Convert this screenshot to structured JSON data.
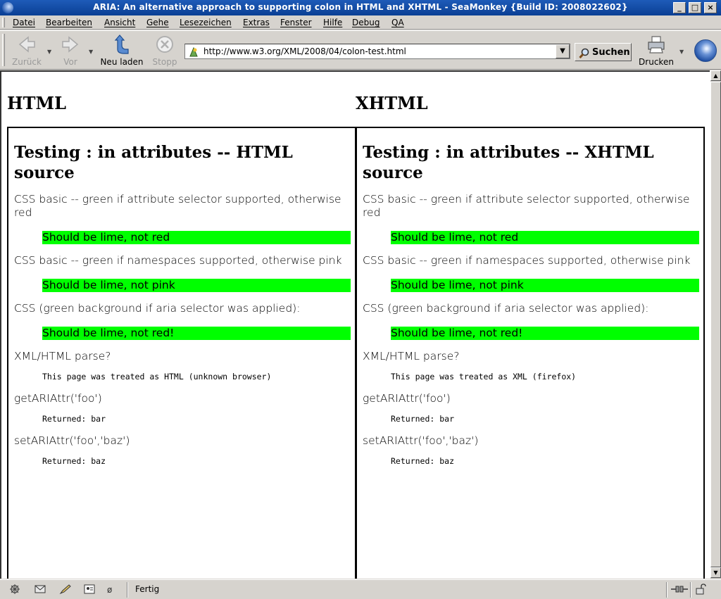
{
  "window": {
    "title": "ARIA: An alternative approach to supporting colon in HTML and XHTML - SeaMonkey {Build ID: 2008022602}"
  },
  "menu": [
    "Datei",
    "Bearbeiten",
    "Ansicht",
    "Gehe",
    "Lesezeichen",
    "Extras",
    "Fenster",
    "Hilfe",
    "Debug",
    "QA"
  ],
  "toolbar": {
    "back_label": "Zurück",
    "forward_label": "Vor",
    "reload_label": "Neu laden",
    "stop_label": "Stopp",
    "url": "http://www.w3.org/XML/2008/04/colon-test.html",
    "search_label": "Suchen",
    "print_label": "Drucken"
  },
  "page": {
    "left": {
      "heading": "HTML",
      "title": "Testing : in attributes -- HTML source",
      "p1": "CSS basic -- green if attribute selector supported, otherwise red",
      "lime1": "Should be lime, not red",
      "p2": "CSS basic -- green if namespaces supported, otherwise pink",
      "lime2": "Should be lime, not pink",
      "p3": "CSS (green background if aria selector was applied):",
      "lime3": "Should be lime, not red!",
      "p4": "XML/HTML parse?",
      "code1": "This page was treated as HTML (unknown browser)",
      "p5": "getARIAttr('foo')",
      "code2": "Returned: bar",
      "p6": "setARIAttr('foo','baz')",
      "code3": "Returned: baz"
    },
    "right": {
      "heading": "XHTML",
      "title": "Testing : in attributes -- XHTML source",
      "p1": "CSS basic -- green if attribute selector supported, otherwise red",
      "lime1": "Should be lime, not red",
      "p2": "CSS basic -- green if namespaces supported, otherwise pink",
      "lime2": "Should be lime, not pink",
      "p3": "CSS (green background if aria selector was applied):",
      "lime3": "Should be lime, not red!",
      "p4": "XML/HTML parse?",
      "code1": "This page was treated as XML (firefox)",
      "p5": "getARIAttr('foo')",
      "code2": "Returned: bar",
      "p6": "setARIAttr('foo','baz')",
      "code3": "Returned: baz"
    }
  },
  "status": {
    "text": "Fertig"
  },
  "colors": {
    "lime": "#00ff00",
    "titlebar": "#0a3f94",
    "chrome": "#d6d3ce"
  }
}
